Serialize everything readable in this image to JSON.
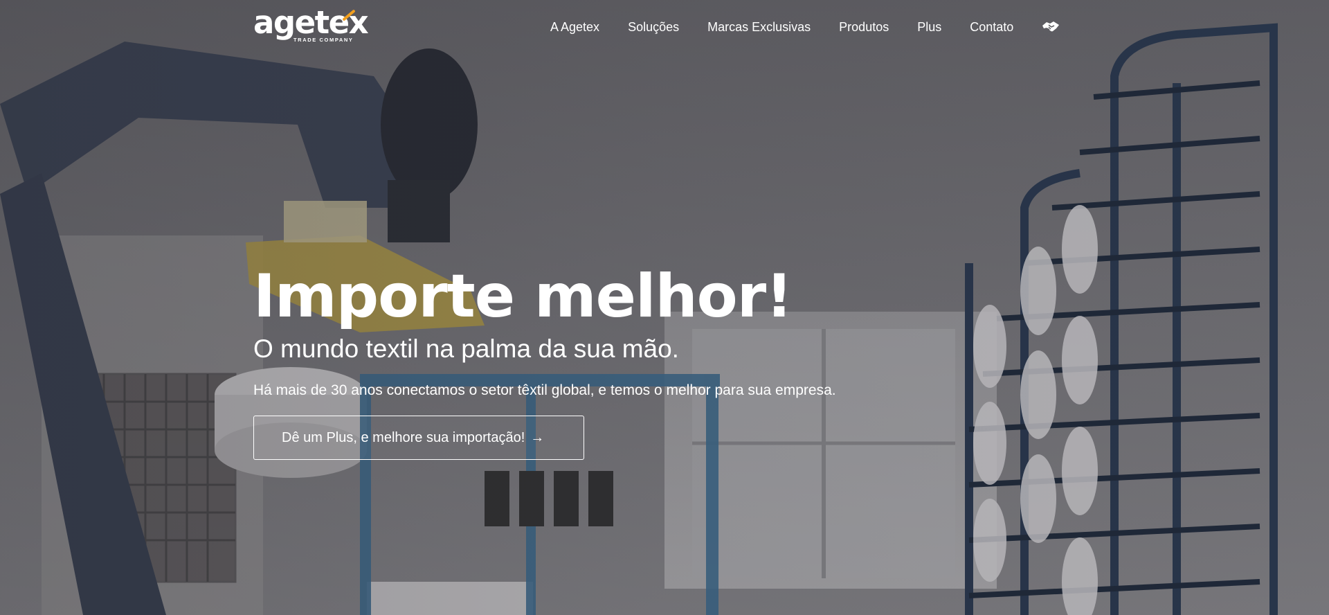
{
  "brand": {
    "name": "agetex",
    "tagline": "TRADE COMPANY",
    "accent_color": "#f29f1d"
  },
  "nav": {
    "items": [
      {
        "label": "A Agetex"
      },
      {
        "label": "Soluções"
      },
      {
        "label": "Marcas Exclusivas"
      },
      {
        "label": "Produtos"
      },
      {
        "label": "Plus"
      },
      {
        "label": "Contato"
      }
    ],
    "icon": "handshake-icon"
  },
  "hero": {
    "title": "Importe melhor!",
    "subtitle": "O mundo textil na palma da sua mão.",
    "text": "Há mais de 30 anos conectamos o setor têxtil global, e temos o melhor para sua empresa.",
    "cta_label": "Dê um Plus, e melhore sua importação!",
    "cta_arrow": "→",
    "background": "factory-robot-arm-textile-spools-photo"
  }
}
